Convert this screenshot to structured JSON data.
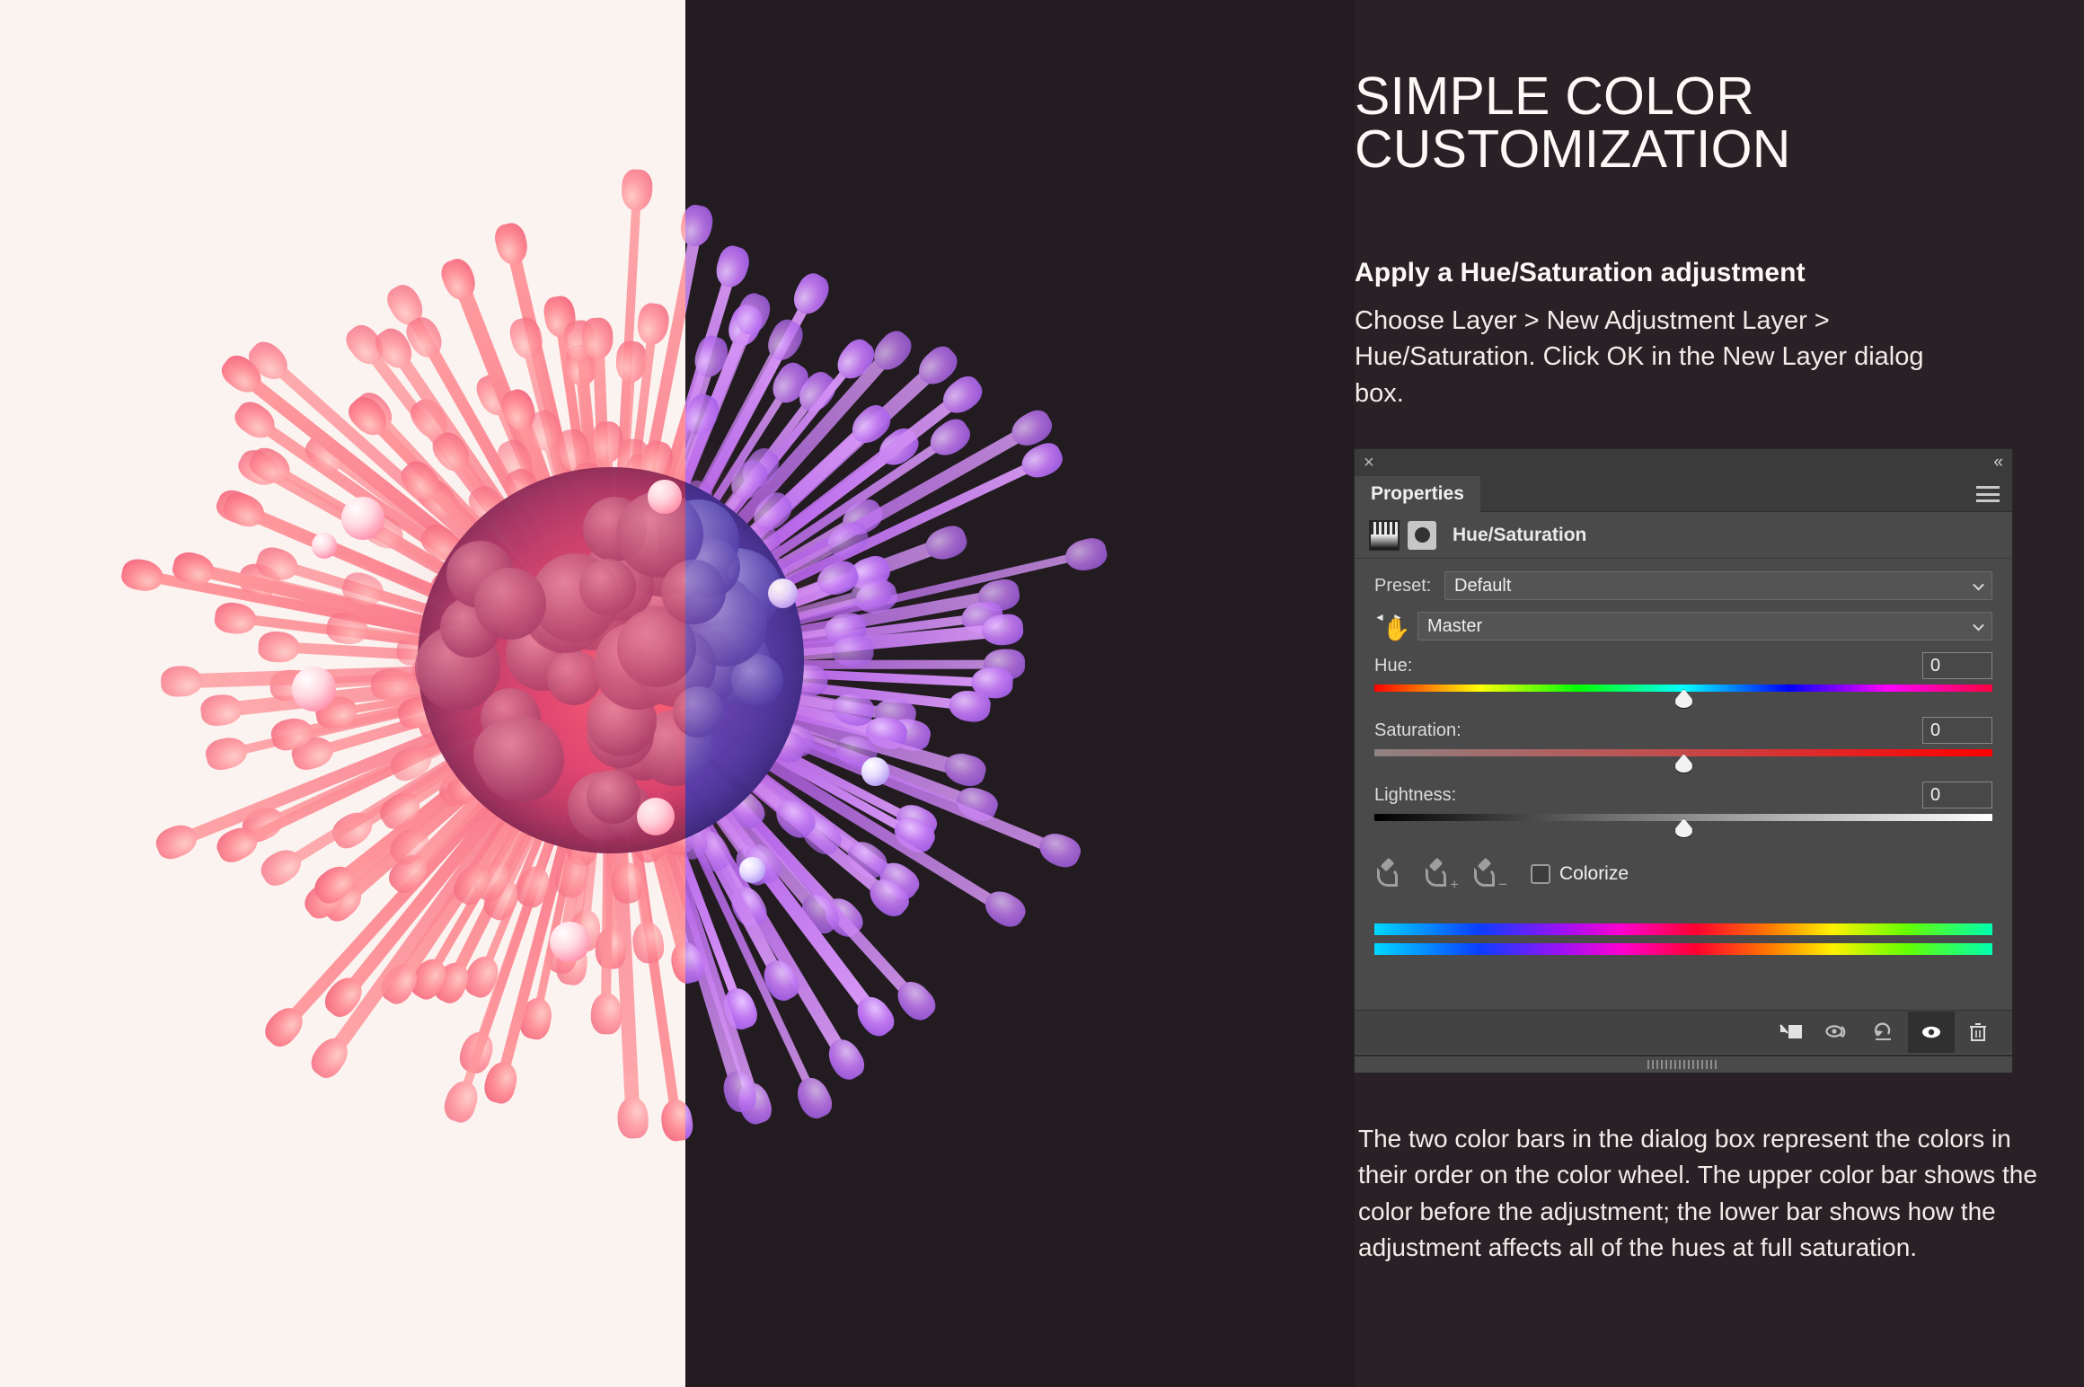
{
  "artwork": {
    "description": "spiky-organic-sphere",
    "left_background_color": "#faf3f0",
    "right_background_color": "#221c21",
    "left_half_color": "#f0637f",
    "right_half_color": "#a86ae8"
  },
  "article": {
    "heading": "SIMPLE COLOR CUSTOMIZATION",
    "subheading": "Apply a Hue/Saturation adjustment",
    "body": "Choose Layer > New Adjustment Layer > Hue/Saturation. Click OK in the New Layer dialog box.",
    "footnote": "The two color bars in the dialog box represent the colors in their order on the color wheel. The upper color bar shows the color before the adjustment; the lower bar shows how the adjustment affects all of the hues at full saturation.",
    "text_color": "#fdf9f7",
    "background_color": "#2a2126"
  },
  "panel": {
    "tab_label": "Properties",
    "close_icon": "×",
    "collapse_icon": "«",
    "menu_icon": "hamburger-menu-icon",
    "layer": {
      "name": "Hue/Saturation",
      "thumbnail_icon": "gradient-thumbnail-icon",
      "mask_icon": "layer-mask-icon"
    },
    "preset": {
      "label": "Preset:",
      "value": "Default"
    },
    "channel": {
      "value": "Master",
      "targeted_adjustment_icon": "targeted-adjustment-hand-icon"
    },
    "sliders": [
      {
        "label": "Hue:",
        "value": "0",
        "position_pct": 50,
        "track": "hue"
      },
      {
        "label": "Saturation:",
        "value": "0",
        "position_pct": 50,
        "track": "saturation"
      },
      {
        "label": "Lightness:",
        "value": "0",
        "position_pct": 50,
        "track": "lightness"
      }
    ],
    "eyedroppers": [
      {
        "name": "eyedropper-icon",
        "sign": ""
      },
      {
        "name": "eyedropper-add-icon",
        "sign": "+"
      },
      {
        "name": "eyedropper-minus-icon",
        "sign": "−"
      }
    ],
    "colorize": {
      "label": "Colorize",
      "checked": false
    },
    "color_bars": {
      "upper_label": "before-adjustment-color-bar",
      "lower_label": "after-adjustment-color-bar",
      "stops": [
        "#00d8ff",
        "#0b3dff",
        "#9a12f5",
        "#ff00d0",
        "#ff0030",
        "#ff7a00",
        "#fff000",
        "#66ff00",
        "#00ffb0"
      ]
    },
    "footer_buttons": [
      {
        "name": "clip-to-layer-button",
        "icon": "clip-to-layer-icon",
        "active": false
      },
      {
        "name": "toggle-mask-view-button",
        "icon": "eye-arrow-icon",
        "active": false
      },
      {
        "name": "reset-button",
        "icon": "reset-arrow-icon",
        "active": false
      },
      {
        "name": "toggle-visibility-button",
        "icon": "eye-icon",
        "active": true
      },
      {
        "name": "delete-layer-button",
        "icon": "trash-icon",
        "active": false
      }
    ],
    "background_color": "#4a4a4a",
    "header_color": "#3b3b3b"
  }
}
